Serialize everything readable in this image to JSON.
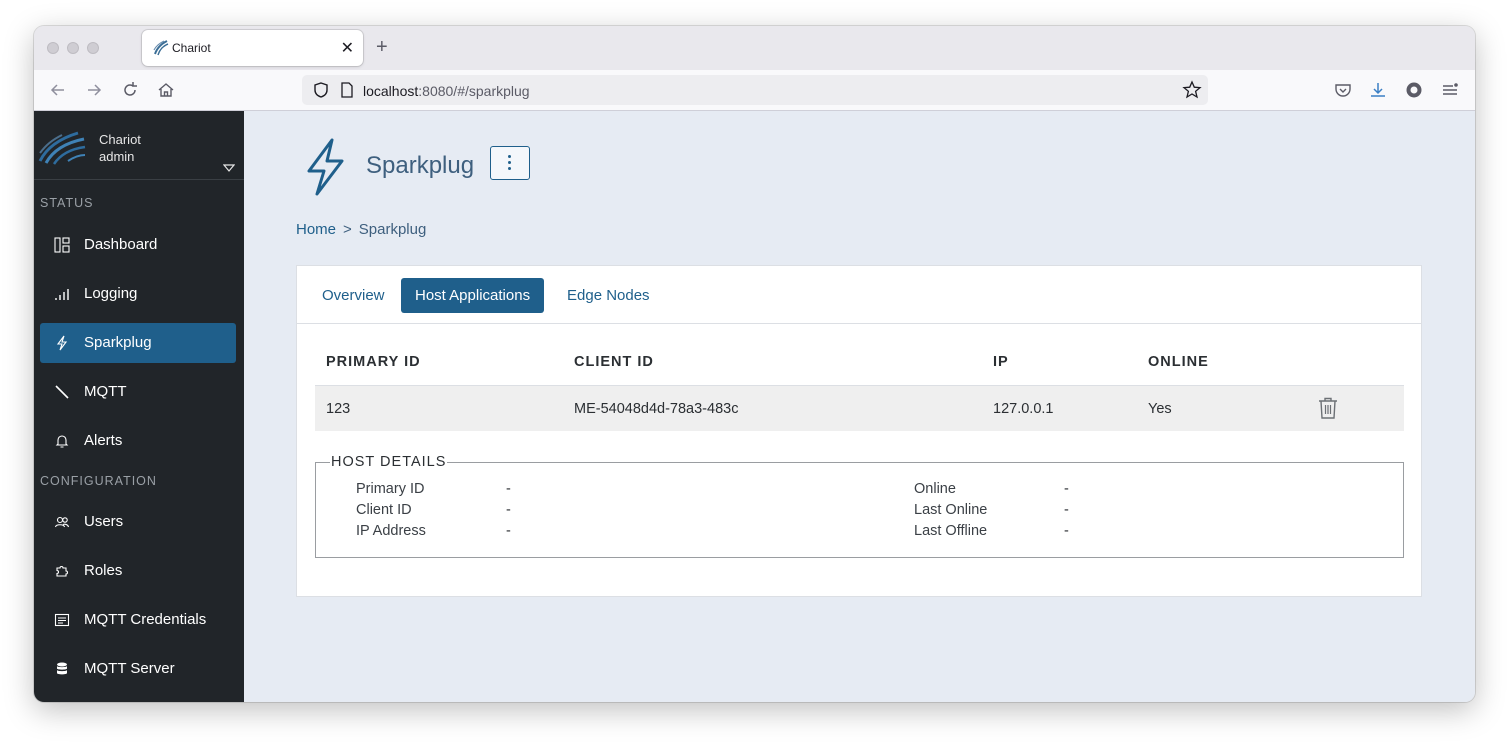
{
  "browser": {
    "tab_title": "Chariot",
    "url_host": "localhost",
    "url_rest": ":8080/#/sparkplug"
  },
  "user": {
    "org": "Chariot",
    "name": "admin"
  },
  "sidebar": {
    "status_label": "STATUS",
    "configuration_label": "CONFIGURATION",
    "items": [
      {
        "label": "Dashboard",
        "icon": "dashboard-icon"
      },
      {
        "label": "Logging",
        "icon": "chart-bars-icon"
      },
      {
        "label": "Sparkplug",
        "icon": "lightning-icon",
        "active": true
      },
      {
        "label": "MQTT",
        "icon": "slash-icon"
      },
      {
        "label": "Alerts",
        "icon": "bell-icon"
      },
      {
        "label": "Users",
        "icon": "users-icon"
      },
      {
        "label": "Roles",
        "icon": "puzzle-icon"
      },
      {
        "label": "MQTT Credentials",
        "icon": "credentials-icon"
      },
      {
        "label": "MQTT Server",
        "icon": "database-icon"
      }
    ]
  },
  "page": {
    "title": "Sparkplug",
    "breadcrumb_home": "Home",
    "breadcrumb_sep": ">",
    "breadcrumb_current": "Sparkplug"
  },
  "tabs": [
    {
      "label": "Overview",
      "active": false
    },
    {
      "label": "Host Applications",
      "active": true
    },
    {
      "label": "Edge Nodes",
      "active": false
    }
  ],
  "table": {
    "headers": [
      "PRIMARY ID",
      "CLIENT ID",
      "IP",
      "ONLINE"
    ],
    "rows": [
      [
        "123",
        "ME-54048d4d-78a3-483c",
        "127.0.0.1",
        "Yes"
      ]
    ]
  },
  "host_details": {
    "legend": "HOST DETAILS",
    "left": [
      {
        "label": "Primary ID",
        "value": "-"
      },
      {
        "label": "Client ID",
        "value": "-"
      },
      {
        "label": "IP Address",
        "value": "-"
      }
    ],
    "right": [
      {
        "label": "Online",
        "value": "-"
      },
      {
        "label": "Last Online",
        "value": "-"
      },
      {
        "label": "Last Offline",
        "value": "-"
      }
    ]
  },
  "colors": {
    "sidebar_bg": "#212529",
    "accent": "#1f5f8b",
    "content_bg": "#e6ebf3"
  }
}
